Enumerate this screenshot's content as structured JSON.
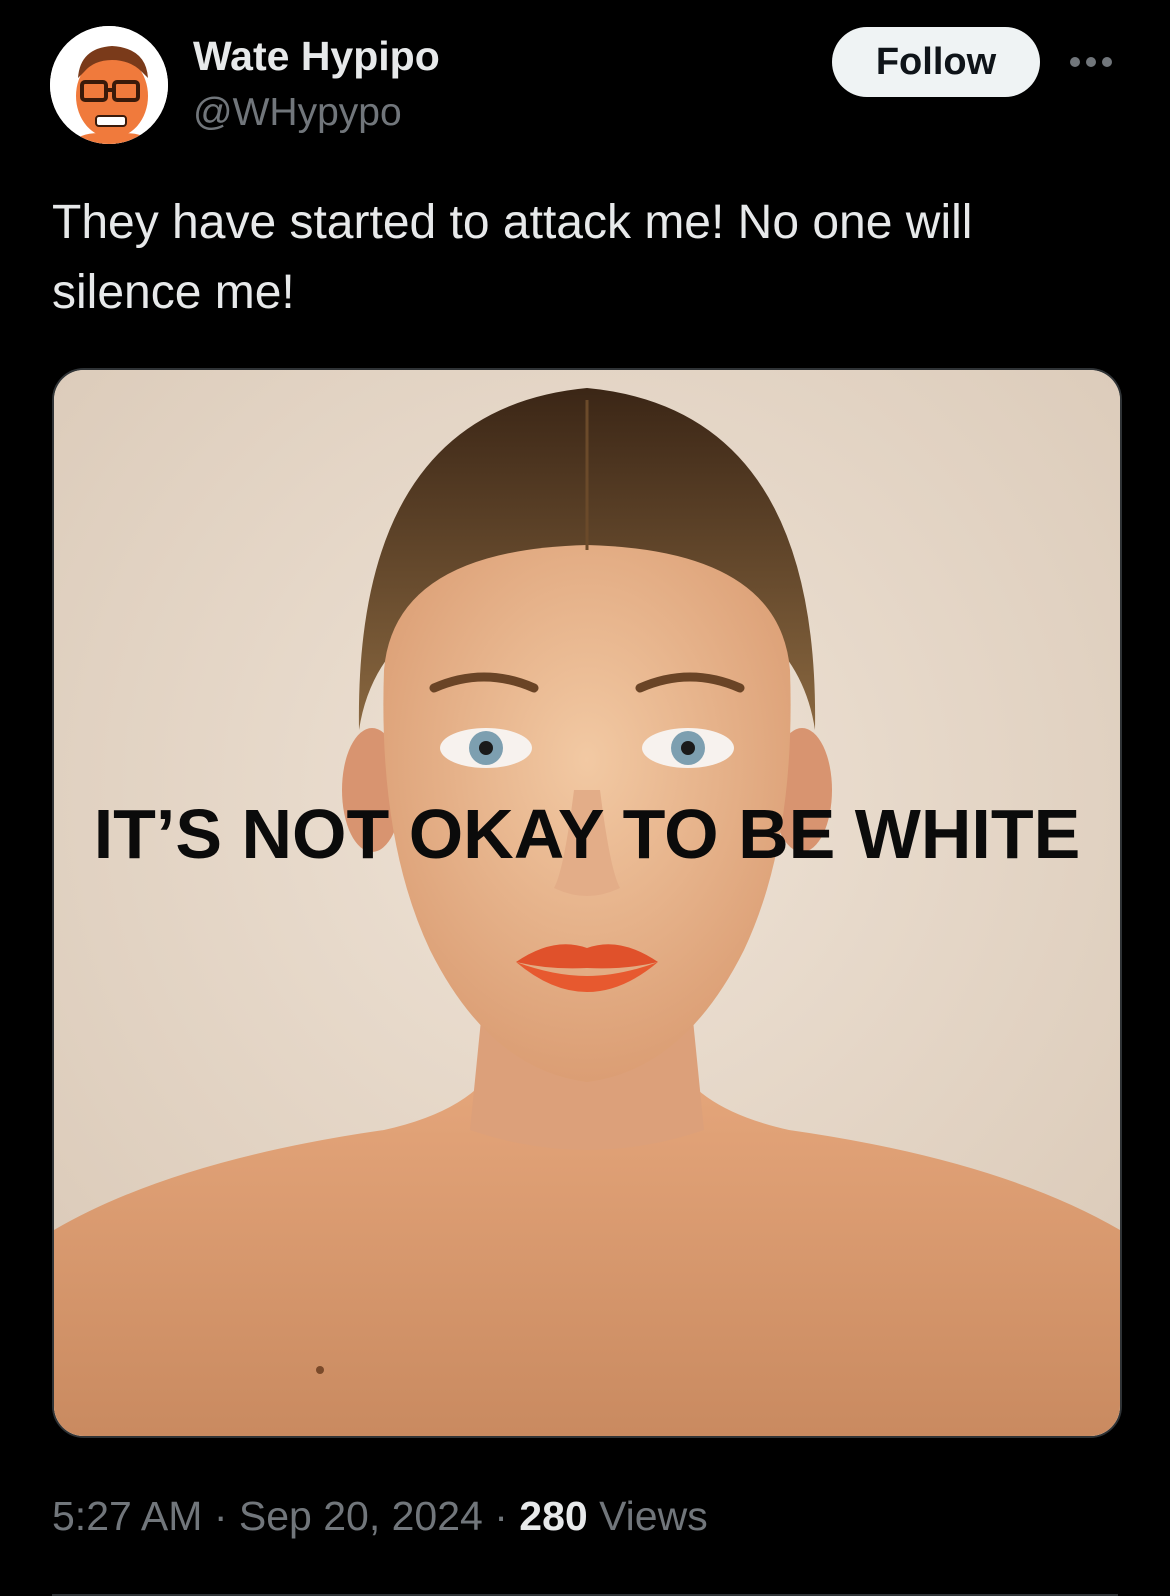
{
  "author": {
    "display_name": "Wate Hypipo",
    "handle": "@WHypypo",
    "avatar_icon": "cartoon-avatar-icon"
  },
  "actions": {
    "follow_label": "Follow",
    "more_icon": "more-dots-icon"
  },
  "tweet": {
    "text": "They have started to attack me! No one will silence me!"
  },
  "media": {
    "overlay_text": "IT’S NOT OKAY TO BE WHITE",
    "description_icon": "portrait-photo"
  },
  "meta": {
    "time": "5:27 AM",
    "separator1": " · ",
    "date": "Sep 20, 2024",
    "separator2": " · ",
    "views_count": "280",
    "views_label": " Views"
  },
  "colors": {
    "background": "#000000",
    "primary_text": "#e7e9ea",
    "secondary_text": "#71767b",
    "follow_bg": "#eff3f4",
    "follow_text": "#0f1419",
    "border": "#2f3336"
  }
}
